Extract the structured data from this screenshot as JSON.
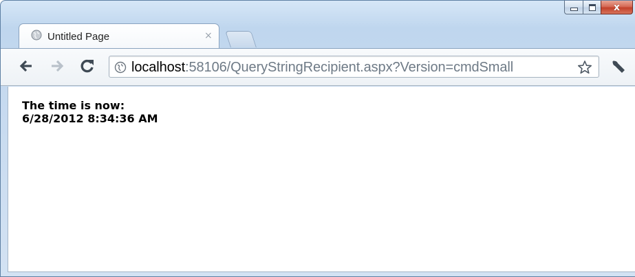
{
  "window": {
    "caption_buttons": {
      "minimize_icon": "minimize-icon",
      "maximize_icon": "maximize-icon",
      "close_icon": "close-icon",
      "close_glyph": "x"
    }
  },
  "tabs": [
    {
      "title": "Untitled Page",
      "icon": "globe-icon",
      "close_glyph": "×",
      "active": true
    }
  ],
  "toolbar": {
    "back_icon": "arrow-left-icon",
    "forward_icon": "arrow-right-icon",
    "reload_icon": "reload-icon",
    "omnibox": {
      "icon": "globe-icon",
      "host": "localhost",
      "rest": ":58106/QueryStringRecipient.aspx?Version=cmdSmall"
    },
    "star_icon": "star-icon",
    "wrench_icon": "wrench-icon"
  },
  "page": {
    "line1": "The time is now:",
    "line2": "6/28/2012 8:34:36 AM"
  },
  "colors": {
    "frame": "#bfd6ee",
    "close_button": "#c2412a",
    "url_rest": "#6e7a86"
  }
}
